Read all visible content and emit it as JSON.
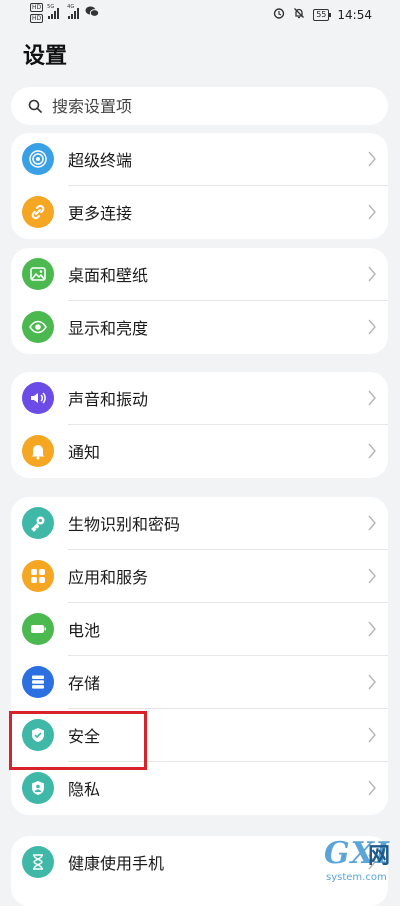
{
  "status_bar": {
    "badge_1": "HD",
    "badge_2": "HD",
    "net_1": "5G",
    "net_2": "4G",
    "battery": "55",
    "time": "14:54"
  },
  "page": {
    "title": "设置"
  },
  "search": {
    "placeholder": "搜索设置项"
  },
  "groups": [
    {
      "items": [
        {
          "label": "超级终端",
          "icon": "super-device-icon",
          "color": "#3aa0e6"
        },
        {
          "label": "更多连接",
          "icon": "link-icon",
          "color": "#f5a623"
        }
      ]
    },
    {
      "items": [
        {
          "label": "桌面和壁纸",
          "icon": "wallpaper-icon",
          "color": "#4cb950"
        },
        {
          "label": "显示和亮度",
          "icon": "eye-icon",
          "color": "#4cb950"
        }
      ]
    },
    {
      "items": [
        {
          "label": "声音和振动",
          "icon": "speaker-icon",
          "color": "#6b4ce6"
        },
        {
          "label": "通知",
          "icon": "bell-icon",
          "color": "#f5a623"
        }
      ]
    },
    {
      "items": [
        {
          "label": "生物识别和密码",
          "icon": "key-icon",
          "color": "#3fb8a8"
        },
        {
          "label": "应用和服务",
          "icon": "apps-icon",
          "color": "#f5a623"
        },
        {
          "label": "电池",
          "icon": "battery-icon",
          "color": "#4cb950"
        },
        {
          "label": "存储",
          "icon": "storage-icon",
          "color": "#2b6fe0"
        },
        {
          "label": "安全",
          "icon": "shield-icon",
          "color": "#3fb8a8"
        },
        {
          "label": "隐私",
          "icon": "privacy-icon",
          "color": "#3fb8a8"
        }
      ]
    },
    {
      "items": [
        {
          "label": "健康使用手机",
          "icon": "hourglass-icon",
          "color": "#3fb8a8"
        }
      ]
    }
  ],
  "watermark": {
    "brand": "GXI",
    "cn": "网",
    "site": "system.com"
  }
}
